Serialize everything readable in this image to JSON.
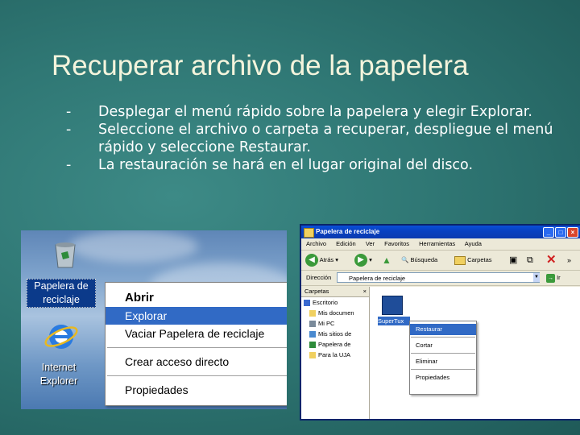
{
  "slide": {
    "title": "Recuperar archivo de la papelera",
    "bullets": [
      {
        "marker": "-",
        "text": "Desplegar el menú rápido sobre la papelera y elegir Explorar."
      },
      {
        "marker": "-",
        "text": "Seleccione el archivo o carpeta a recuperar, despliegue el menú rápido y seleccione Restaurar."
      },
      {
        "marker": "-",
        "text": "La restauración se hará en el lugar original del disco."
      }
    ]
  },
  "desktop": {
    "recycle_label_1": "Papelera de",
    "recycle_label_2": "reciclaje",
    "ie_label_1": "Internet",
    "ie_label_2": "Explorer",
    "context_menu": [
      "Abrir",
      "Explorar",
      "Vaciar Papelera de reciclaje",
      "Crear acceso directo",
      "Propiedades"
    ]
  },
  "explorer": {
    "title": "Papelera de reciclaje",
    "menu": [
      "Archivo",
      "Edición",
      "Ver",
      "Favoritos",
      "Herramientas",
      "Ayuda"
    ],
    "toolbar": {
      "back": "Atrás",
      "search": "Búsqueda",
      "folders": "Carpetas"
    },
    "address_label": "Dirección",
    "address_value": "Papelera de reciclaje",
    "go": "Ir",
    "tree_header": "Carpetas",
    "tree": [
      "Escritorio",
      "Mis documen",
      "Mi PC",
      "Mis sitios de",
      "Papelera de",
      "Para la UJA"
    ],
    "file_label": "SuperTux",
    "file_menu": [
      "Restaurar",
      "Cortar",
      "Eliminar",
      "Propiedades"
    ]
  }
}
